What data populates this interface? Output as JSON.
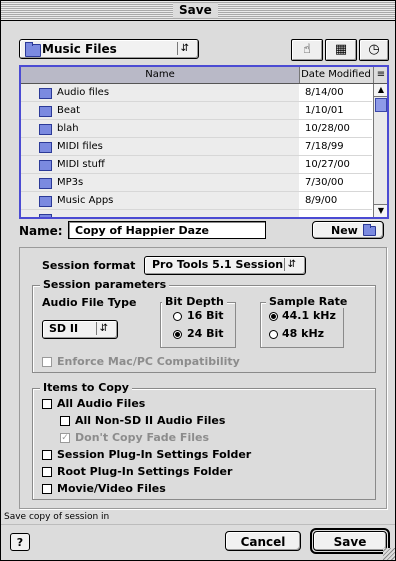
{
  "window": {
    "title": "Save"
  },
  "location_popup": {
    "label": "Music Files"
  },
  "list": {
    "columns": [
      "Name",
      "Date Modified",
      "≡"
    ],
    "rows": [
      {
        "name": "Audio files",
        "date": "8/14/00"
      },
      {
        "name": "Beat",
        "date": "1/10/01"
      },
      {
        "name": "blah",
        "date": "10/28/00"
      },
      {
        "name": "MIDI files",
        "date": "7/18/99"
      },
      {
        "name": "MIDI stuff",
        "date": "10/27/00"
      },
      {
        "name": "MP3s",
        "date": "7/30/00"
      },
      {
        "name": "Music Apps",
        "date": "8/9/00"
      }
    ]
  },
  "name_field": {
    "label": "Name:",
    "value": "Copy of Happier Daze"
  },
  "new_button": {
    "label": "New"
  },
  "session": {
    "format_label": "Session format",
    "format_value": "Pro Tools 5.1 Session",
    "params_label": "Session parameters",
    "audio_file_type_label": "Audio File Type",
    "audio_file_type_value": "SD II",
    "bit_depth_label": "Bit Depth",
    "bit_16": "16 Bit",
    "bit_24": "24 Bit",
    "sample_rate_label": "Sample Rate",
    "rate_441": "44.1 kHz",
    "rate_48": "48 kHz",
    "compat_label": "Enforce Mac/PC Compatibility"
  },
  "items": {
    "title": "Items to Copy",
    "all_audio": "All Audio Files",
    "non_sd2": "All Non-SD II Audio Files",
    "no_fade": "Don't Copy Fade Files",
    "session_plugin": "Session Plug-In Settings Folder",
    "root_plugin": "Root Plug-In Settings Folder",
    "movie": "Movie/Video Files"
  },
  "status": {
    "text": "Save copy of session in"
  },
  "buttons": {
    "help": "?",
    "cancel": "Cancel",
    "save": "Save"
  },
  "icons": {
    "folder": "folder-icon",
    "desktop": "desktop-icon",
    "shortcuts": "shortcuts-icon",
    "recent": "recent-clock-icon"
  }
}
